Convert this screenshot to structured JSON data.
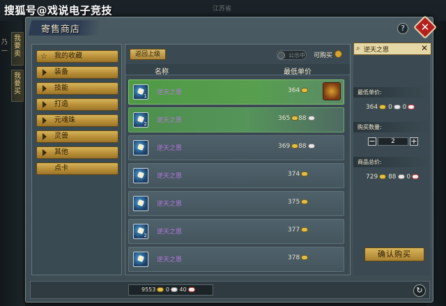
{
  "watermark": "搜狐号@戏说电子竞技",
  "top_faded_text": "江苏省",
  "side_tabs": [
    "我要卖",
    "我要买"
  ],
  "window": {
    "title": "寄售商店",
    "help_label": "?",
    "close_label": "✕"
  },
  "categories": [
    "我的收藏",
    "装备",
    "技能",
    "打造",
    "元魂珠",
    "灵兽",
    "其他",
    "点卡"
  ],
  "list": {
    "back_label": "返回上级",
    "toggle_label": "公示中",
    "buyable_label": "可购买",
    "header_name": "名称",
    "header_price": "最低单价",
    "rows": [
      {
        "name": "逆天之恩",
        "gold": "364",
        "silver": ""
      },
      {
        "name": "逆天之恩",
        "gold": "365",
        "silver": "88"
      },
      {
        "name": "逆天之恩",
        "gold": "369",
        "silver": "88"
      },
      {
        "name": "逆天之恩",
        "gold": "374",
        "silver": ""
      },
      {
        "name": "逆天之恩",
        "gold": "375",
        "silver": ""
      },
      {
        "name": "逆天之恩",
        "gold": "377",
        "silver": ""
      },
      {
        "name": "逆天之恩",
        "gold": "378",
        "silver": ""
      }
    ],
    "row_counts": [
      "1",
      "2",
      "",
      "",
      "",
      "2",
      ""
    ]
  },
  "right": {
    "search_value": "逆天之恩",
    "search_clear": "✕",
    "unit_price_label": "最低单价:",
    "unit_price": {
      "gold": "364",
      "silver": "0",
      "red": "0"
    },
    "quantity_label": "购买数量:",
    "quantity": "2",
    "total_label": "商品总价:",
    "total": {
      "gold": "729",
      "silver": "88",
      "red": "0"
    },
    "confirm_label": "确认购买"
  },
  "footer": {
    "gold": "9553",
    "silver": "0",
    "red": "40"
  },
  "colors": {
    "panel": "#3b4a52",
    "gold_button": "#d6b45a",
    "selected_row": "#4f9a46",
    "item_name": "#b577e0"
  }
}
